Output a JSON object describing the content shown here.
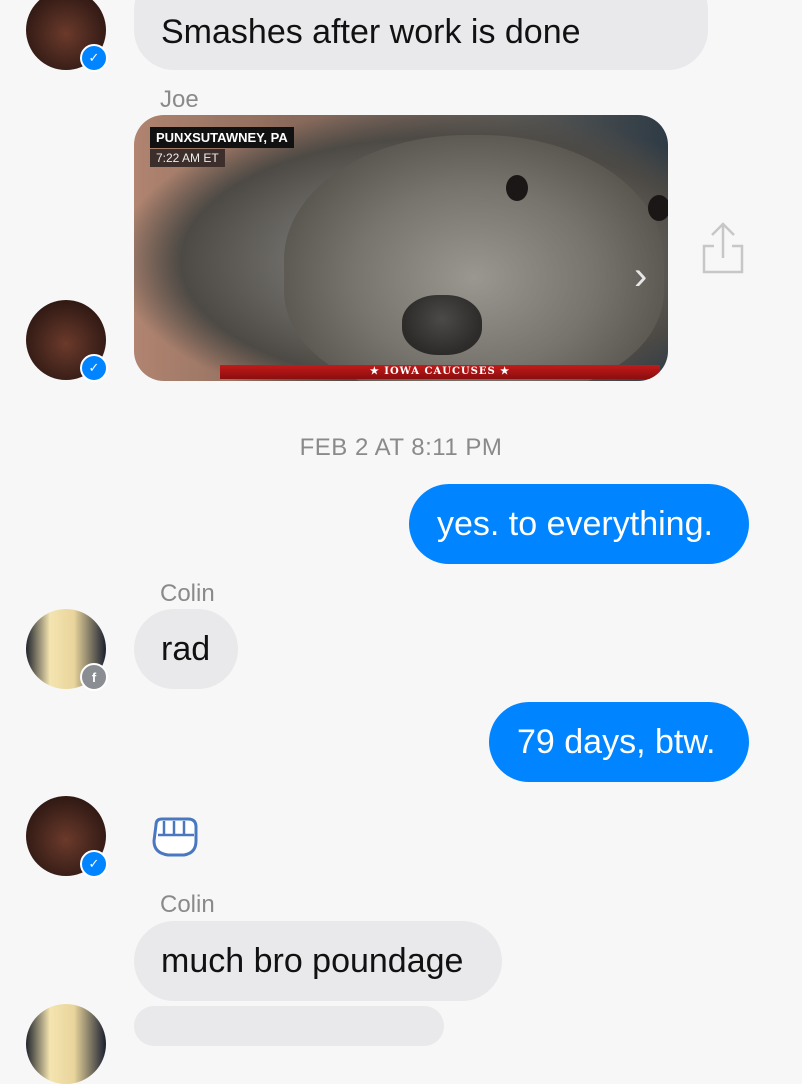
{
  "messages": {
    "top_partial": "Smashes after work is done",
    "sender_joe": "Joe",
    "photo": {
      "caption_location": "PUNXSUTAWNEY, PA",
      "caption_time": "7:22 AM ET",
      "ticker": "★ IOWA CAUCUSES ★"
    },
    "timestamp": "FEB 2 AT 8:11 PM",
    "out_1": "yes. to everything.",
    "sender_colin_1": "Colin",
    "in_rad": "rad",
    "out_2": "79 days, btw.",
    "sender_colin_2": "Colin",
    "in_bro": "much bro poundage"
  },
  "colors": {
    "bubble_out": "#0084ff",
    "bubble_in": "#e9e9eb",
    "background": "#f7f7f7"
  },
  "icons": [
    "messenger-badge-icon",
    "facebook-badge-icon",
    "share-icon",
    "chevron-right-icon",
    "fist-bump-icon"
  ]
}
